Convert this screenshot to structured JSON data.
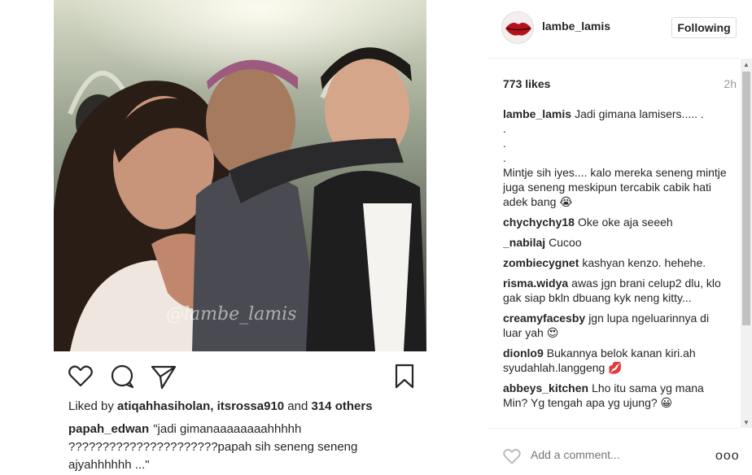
{
  "post": {
    "watermark": "@lambe_lamis",
    "liked_by_prefix": "Liked by",
    "liked_by_users": "atiqahhasiholan, itsrossa910",
    "liked_by_and": "and",
    "liked_by_others": "314 others",
    "caption_user": "papah_edwan",
    "caption_text": "\"jadi gimanaaaaaaaahhhhh ??????????????????????papah sih seneng seneng ajyahhhhhh ...\""
  },
  "header": {
    "username": "lambe_lamis",
    "follow_label": "Following"
  },
  "stats": {
    "likes": "773 likes",
    "time": "2h"
  },
  "comments": [
    {
      "user": "lambe_lamis",
      "text": "Jadi gimana lamisers..... .\n.\n.\n.\nMintje sih iyes.... kalo mereka seneng mintje juga seneng meskipun tercabik cabik hati adek bang 😭"
    },
    {
      "user": "chychychy18",
      "text": "Oke oke aja seeeh"
    },
    {
      "user": "_nabilaj",
      "text": "Cucoo"
    },
    {
      "user": "zombiecygnet",
      "text": "kashyan kenzo. hehehe."
    },
    {
      "user": "risma.widya",
      "text": "awas jgn brani celup2 dlu, klo gak siap bkln dbuang kyk neng kitty..."
    },
    {
      "user": "creamyfacesby",
      "text": "jgn lupa ngeluarinnya di luar yah 😍"
    },
    {
      "user": "dionlo9",
      "text": "Bukannya belok kanan kiri.ah syudahlah.langgeng 💋"
    },
    {
      "user": "abbeys_kitchen",
      "text": "Lho itu sama yg mana Min? Yg tengah apa yg ujung? 😀"
    }
  ],
  "footer": {
    "comment_placeholder": "Add a comment...",
    "more_label": "ooo"
  },
  "icons": {
    "like": "heart-icon",
    "comment": "comment-bubble-icon",
    "share": "share-plane-icon",
    "save": "bookmark-icon",
    "more": "more-options-icon"
  },
  "colors": {
    "text": "#262626",
    "muted": "#999999",
    "border": "#dbdbdb"
  }
}
